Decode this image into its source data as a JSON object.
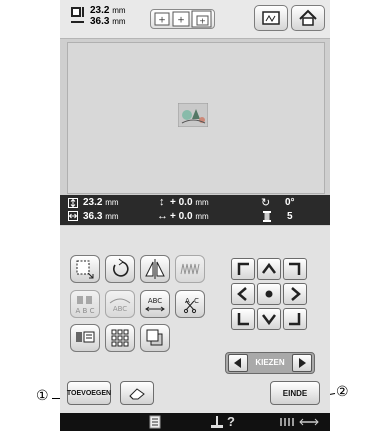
{
  "header": {
    "width_value": "23.2",
    "height_value": "36.3",
    "unit": "mm"
  },
  "info_bar": {
    "height_value": "23.2",
    "width_value": "36.3",
    "unit": "mm",
    "offset_y": "+   0.0",
    "offset_x": "+   0.0",
    "rotation": "0°",
    "color_count": "5"
  },
  "bottom": {
    "add_label": "TOEVOEGEN",
    "end_label": "EINDE"
  },
  "kiezen": {
    "label": "KIEZEN"
  },
  "edit_buttons": {
    "abc_label": "ABC",
    "abc_label_disabled": "ABC"
  },
  "status": {
    "help_label": "?"
  },
  "callouts": {
    "left": "①",
    "right": "②"
  }
}
